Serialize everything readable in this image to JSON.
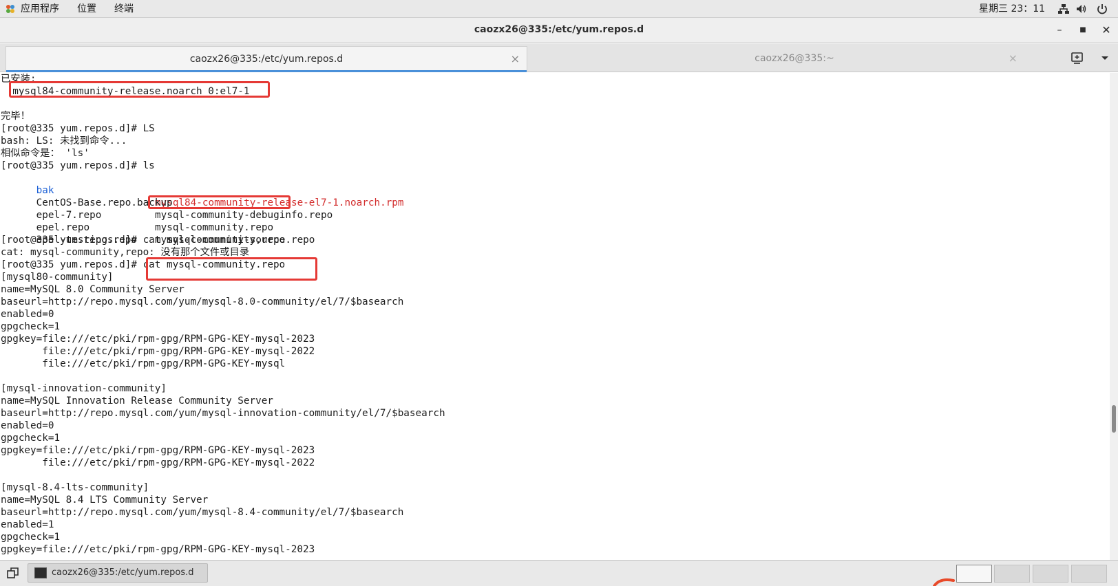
{
  "top_panel": {
    "apps_label": "应用程序",
    "places_label": "位置",
    "terminal_label": "终端",
    "clock": "星期三 23：11"
  },
  "window": {
    "title": "caozx26@335:/etc/yum.repos.d"
  },
  "tabs": [
    {
      "label": "caozx26@335:/etc/yum.repos.d",
      "active": true
    },
    {
      "label": "caozx26@335:~",
      "active": false
    }
  ],
  "terminal": {
    "lines": [
      "已安装:",
      "  mysql84-community-release.noarch 0:el7-1",
      "",
      "完毕！",
      "[root@335 yum.repos.d]# LS",
      "bash: LS: 未找到命令...",
      "相似命令是： 'ls'",
      "[root@335 yum.repos.d]# ls"
    ],
    "ls_rows": [
      {
        "col1": "bak",
        "col2": "mysql84-community-release-el7-1.noarch.rpm"
      },
      {
        "col1": "CentOS-Base.repo.backup",
        "col2": "mysql-community-debuginfo.repo"
      },
      {
        "col1": "epel-7.repo",
        "col2": "mysql-community.repo"
      },
      {
        "col1": "epel.repo",
        "col2": "mysql-community-source.repo"
      },
      {
        "col1": "epel-testing.repo",
        "col2": ""
      }
    ],
    "lines_after": [
      "[root@335 yum.repos.d]# cat mysql-community,repo",
      "cat: mysql-community,repo: 没有那个文件或目录",
      "[root@335 yum.repos.d]# cat mysql-community.repo",
      "[mysql80-community]",
      "name=MySQL 8.0 Community Server",
      "baseurl=http://repo.mysql.com/yum/mysql-8.0-community/el/7/$basearch",
      "enabled=0",
      "gpgcheck=1",
      "gpgkey=file:///etc/pki/rpm-gpg/RPM-GPG-KEY-mysql-2023",
      "       file:///etc/pki/rpm-gpg/RPM-GPG-KEY-mysql-2022",
      "       file:///etc/pki/rpm-gpg/RPM-GPG-KEY-mysql",
      "",
      "[mysql-innovation-community]",
      "name=MySQL Innovation Release Community Server",
      "baseurl=http://repo.mysql.com/yum/mysql-innovation-community/el/7/$basearch",
      "enabled=0",
      "gpgcheck=1",
      "gpgkey=file:///etc/pki/rpm-gpg/RPM-GPG-KEY-mysql-2023",
      "       file:///etc/pki/rpm-gpg/RPM-GPG-KEY-mysql-2022",
      "",
      "[mysql-8.4-lts-community]",
      "name=MySQL 8.4 LTS Community Server",
      "baseurl=http://repo.mysql.com/yum/mysql-8.4-community/el/7/$basearch",
      "enabled=1",
      "gpgcheck=1",
      "gpgkey=file:///etc/pki/rpm-gpg/RPM-GPG-KEY-mysql-2023"
    ]
  },
  "taskbar": {
    "task_label": "caozx26@335:/etc/yum.repos.d"
  },
  "icons": {
    "apps": "apps-icon",
    "network": "network-icon",
    "volume": "volume-icon",
    "power": "power-icon",
    "new_tab": "new-tab-icon",
    "tab_menu": "chevron-down-icon",
    "show_desktop": "show-desktop-icon"
  },
  "colors": {
    "highlight_box": "#e53935",
    "directory_blue": "#1a5fd6",
    "rpm_red": "#d32f2f",
    "active_tab_underline": "#4a90d9"
  }
}
